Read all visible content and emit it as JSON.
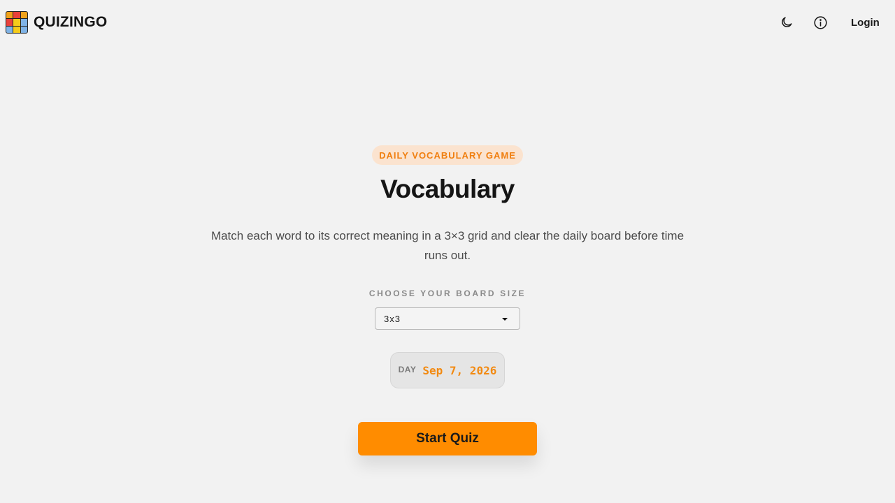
{
  "brand": {
    "name": "QUIZINGO",
    "logo_colors": [
      "#f0a21a",
      "#e8413b",
      "#f0a21a",
      "#e8413b",
      "#f5cc1a",
      "#7fb3e6",
      "#7fb3e6",
      "#f5cc1a",
      "#7fb3e6"
    ]
  },
  "header": {
    "theme_icon": "moon-icon",
    "info_icon": "info-icon",
    "login_label": "Login"
  },
  "hero": {
    "badge": "DAILY VOCABULARY GAME",
    "title": "Vocabulary",
    "description": "Match each word to its correct meaning in a 3×3 grid and clear the daily board before time runs out."
  },
  "board_size": {
    "label": "CHOOSE YOUR BOARD SIZE",
    "selected": "3x3"
  },
  "day": {
    "label": "DAY",
    "value": "Sep 7, 2026"
  },
  "start_button": {
    "label": "Start Quiz"
  },
  "colors": {
    "accent": "#ff8c00",
    "badge_bg": "#fbe3cf",
    "badge_text": "#f07f10",
    "background": "#f2f2f2"
  }
}
